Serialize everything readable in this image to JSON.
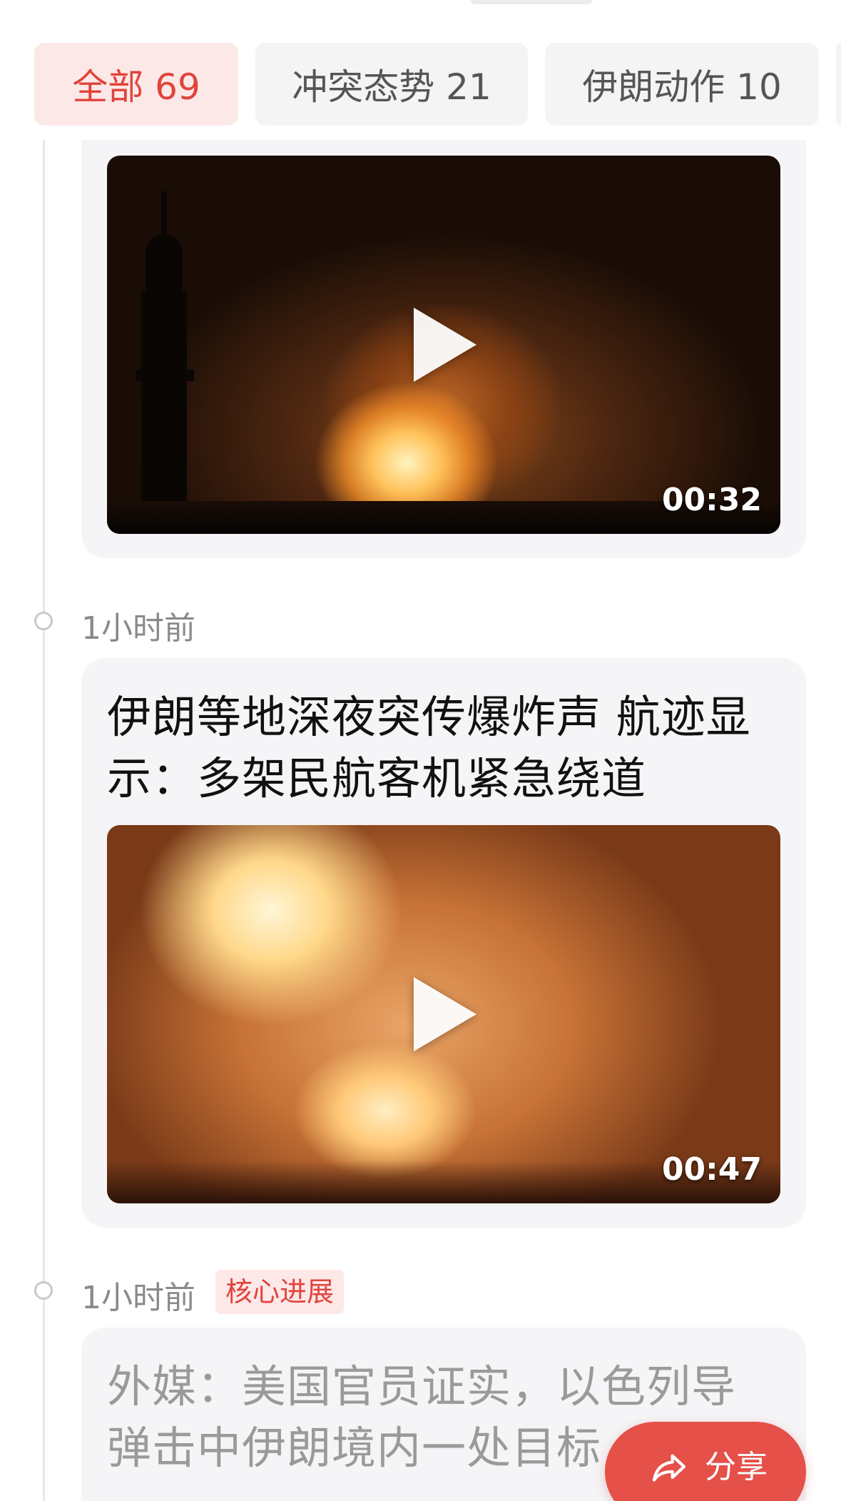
{
  "tabs": [
    {
      "label": "全部 69",
      "active": true
    },
    {
      "label": "冲突态势 21",
      "active": false
    },
    {
      "label": "伊朗动作 10",
      "active": false
    }
  ],
  "feed": {
    "item1": {
      "duration": "00:32"
    },
    "item2": {
      "time": "1小时前",
      "title": "伊朗等地深夜突传爆炸声 航迹显示：多架民航客机紧急绕道",
      "duration": "00:47"
    },
    "item3": {
      "time": "1小时前",
      "tag": "核心进展",
      "title": "外媒：美国官员证实，以色列导弹击中伊朗境内一处目标"
    }
  },
  "share": {
    "label": "分享",
    "icon": "share-arrow-icon"
  },
  "colors": {
    "accent": "#e0443c",
    "tab_active_bg": "#fde8e8",
    "card_bg": "#f5f5f7",
    "share_bg": "#e55048"
  }
}
